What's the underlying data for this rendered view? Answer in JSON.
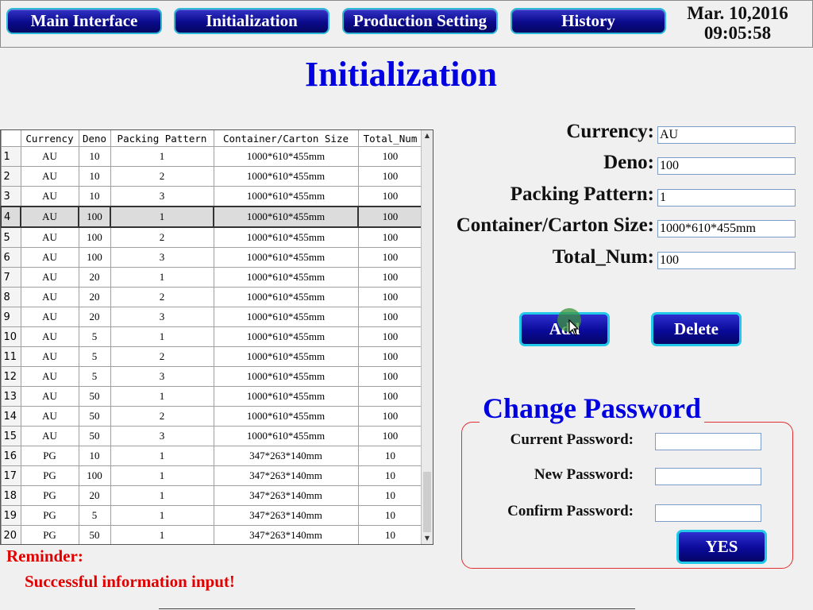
{
  "nav": {
    "main": "Main Interface",
    "init": "Initialization",
    "production": "Production Setting",
    "history": "History"
  },
  "clock": {
    "date": "Mar. 10,2016",
    "time": "09:05:58"
  },
  "page_title": "Initialization",
  "table": {
    "headers": [
      "Currency",
      "Deno",
      "Packing Pattern",
      "Container/Carton Size",
      "Total_Num"
    ],
    "selected_row": 4,
    "rows": [
      {
        "n": "1",
        "cur": "AU",
        "deno": "10",
        "pat": "1",
        "size": "1000*610*455mm",
        "total": "100"
      },
      {
        "n": "2",
        "cur": "AU",
        "deno": "10",
        "pat": "2",
        "size": "1000*610*455mm",
        "total": "100"
      },
      {
        "n": "3",
        "cur": "AU",
        "deno": "10",
        "pat": "3",
        "size": "1000*610*455mm",
        "total": "100"
      },
      {
        "n": "4",
        "cur": "AU",
        "deno": "100",
        "pat": "1",
        "size": "1000*610*455mm",
        "total": "100"
      },
      {
        "n": "5",
        "cur": "AU",
        "deno": "100",
        "pat": "2",
        "size": "1000*610*455mm",
        "total": "100"
      },
      {
        "n": "6",
        "cur": "AU",
        "deno": "100",
        "pat": "3",
        "size": "1000*610*455mm",
        "total": "100"
      },
      {
        "n": "7",
        "cur": "AU",
        "deno": "20",
        "pat": "1",
        "size": "1000*610*455mm",
        "total": "100"
      },
      {
        "n": "8",
        "cur": "AU",
        "deno": "20",
        "pat": "2",
        "size": "1000*610*455mm",
        "total": "100"
      },
      {
        "n": "9",
        "cur": "AU",
        "deno": "20",
        "pat": "3",
        "size": "1000*610*455mm",
        "total": "100"
      },
      {
        "n": "10",
        "cur": "AU",
        "deno": "5",
        "pat": "1",
        "size": "1000*610*455mm",
        "total": "100"
      },
      {
        "n": "11",
        "cur": "AU",
        "deno": "5",
        "pat": "2",
        "size": "1000*610*455mm",
        "total": "100"
      },
      {
        "n": "12",
        "cur": "AU",
        "deno": "5",
        "pat": "3",
        "size": "1000*610*455mm",
        "total": "100"
      },
      {
        "n": "13",
        "cur": "AU",
        "deno": "50",
        "pat": "1",
        "size": "1000*610*455mm",
        "total": "100"
      },
      {
        "n": "14",
        "cur": "AU",
        "deno": "50",
        "pat": "2",
        "size": "1000*610*455mm",
        "total": "100"
      },
      {
        "n": "15",
        "cur": "AU",
        "deno": "50",
        "pat": "3",
        "size": "1000*610*455mm",
        "total": "100"
      },
      {
        "n": "16",
        "cur": "PG",
        "deno": "10",
        "pat": "1",
        "size": "347*263*140mm",
        "total": "10"
      },
      {
        "n": "17",
        "cur": "PG",
        "deno": "100",
        "pat": "1",
        "size": "347*263*140mm",
        "total": "10"
      },
      {
        "n": "18",
        "cur": "PG",
        "deno": "20",
        "pat": "1",
        "size": "347*263*140mm",
        "total": "10"
      },
      {
        "n": "19",
        "cur": "PG",
        "deno": "5",
        "pat": "1",
        "size": "347*263*140mm",
        "total": "10"
      },
      {
        "n": "20",
        "cur": "PG",
        "deno": "50",
        "pat": "1",
        "size": "347*263*140mm",
        "total": "10"
      }
    ]
  },
  "form": {
    "currency_label": "Currency:",
    "currency_value": "AU",
    "deno_label": "Deno:",
    "deno_value": "100",
    "pattern_label": "Packing Pattern:",
    "pattern_value": "1",
    "size_label": "Container/Carton Size:",
    "size_value": "1000*610*455mm",
    "total_label": "Total_Num:",
    "total_value": "100",
    "add_label": "Add",
    "delete_label": "Delete"
  },
  "password": {
    "title": "Change Password",
    "current_label": "Current Password:",
    "new_label": "New Password:",
    "confirm_label": "Confirm Password:",
    "current_value": "",
    "new_value": "",
    "confirm_value": "",
    "yes_label": "YES"
  },
  "reminder": {
    "label": "Reminder:",
    "message": "Successful information input!"
  },
  "colors": {
    "title_blue": "#0000e0",
    "button_blue": "#0a0a8c",
    "button_border": "#2fb9d9",
    "reminder_red": "#e00000",
    "frame_red": "#e03030"
  }
}
